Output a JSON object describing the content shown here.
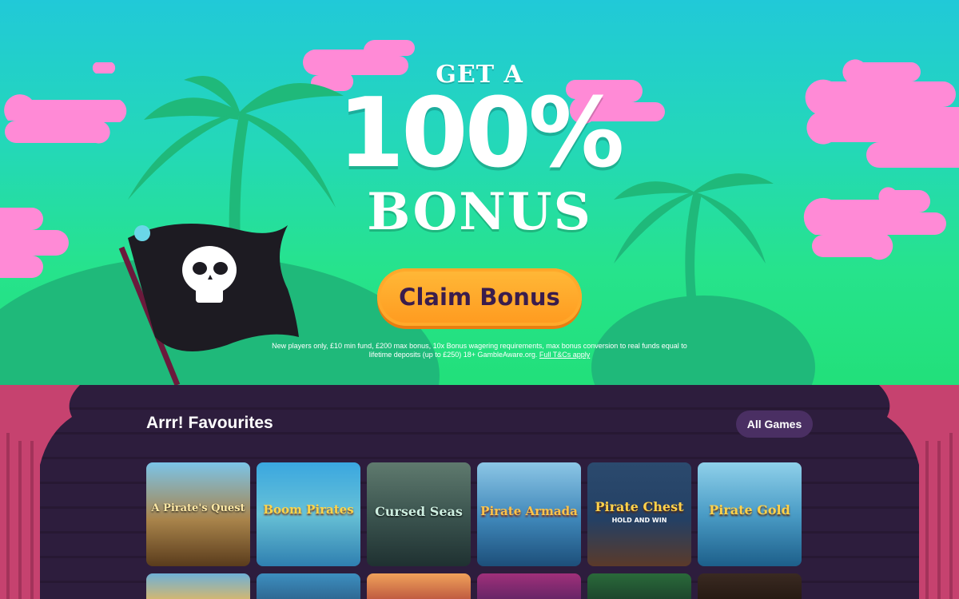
{
  "hero": {
    "line1": "GET A",
    "line2": "100%",
    "line3": "BONUS",
    "cta_label": "Claim Bonus",
    "terms_text": "New players only, £10 min fund, £200 max bonus, 10x Bonus wagering requirements, max bonus conversion to real funds equal to lifetime deposits (up to £250) 18+ GambleAware.org.",
    "terms_link": "Full T&Cs apply"
  },
  "favourites": {
    "title": "Arrr! Favourites",
    "all_games_label": "All Games",
    "games": [
      {
        "name": "A Pirate's Quest"
      },
      {
        "name": "Boom Pirates"
      },
      {
        "name": "Cursed Seas"
      },
      {
        "name": "Pirate Armada"
      },
      {
        "name": "Pirate Chest",
        "subtitle": "HOLD AND WIN"
      },
      {
        "name": "Pirate Gold"
      }
    ]
  },
  "colors": {
    "sky_top": "#21c9d8",
    "grass": "#26e38c",
    "cloud_pink": "#ff8ad6",
    "cta_orange": "#ffa92b",
    "cta_text": "#3a1d4d",
    "panel_bg": "#2d1d3d",
    "pill_bg": "#4a2f63",
    "curtain": "#c6426f"
  }
}
